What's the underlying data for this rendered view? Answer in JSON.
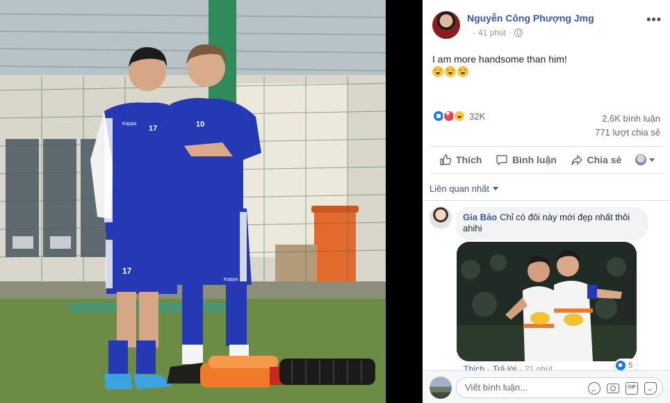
{
  "post": {
    "author": "Nguyễn Công Phượng Jmg",
    "time": "41 phút",
    "privacy_icon": "globe-icon",
    "more_label": "•••",
    "text": "I am more handsome than him!",
    "emojis": [
      "grinning-face-icon",
      "grinning-face-icon",
      "grinning-face-icon"
    ],
    "photo": {
      "jersey_left": "17",
      "jersey_right": "10",
      "sponsor": "Kappa"
    }
  },
  "reactions": {
    "icons": [
      "like-icon",
      "love-icon",
      "haha-icon"
    ],
    "count": "32K",
    "comments": "2,6K bình luận",
    "shares": "771 lượt chia sẻ"
  },
  "actions": {
    "like": "Thích",
    "comment": "Bình luận",
    "share": "Chia sẻ"
  },
  "comments_section": {
    "sort_label": "Liên quan nhất",
    "comment": {
      "name": "Gia Bảo",
      "text": "Chỉ có đôi này mới đẹp nhất thôi ahihi",
      "like_link": "Thích",
      "separator": "·",
      "reply_link": "Trả lời",
      "time": "21 phút",
      "reaction_count": "5"
    },
    "composer_placeholder": "Viết bình luận...",
    "composer_tools": [
      "emoji-icon",
      "camera-icon",
      "gif-icon",
      "sticker-icon"
    ],
    "gif_label": "GIF"
  },
  "colors": {
    "link_blue": "#385898",
    "like_blue": "#1877f2",
    "love_red": "#f33e58",
    "haha_yellow": "#f7c540",
    "jersey_blue": "#2639b5"
  }
}
